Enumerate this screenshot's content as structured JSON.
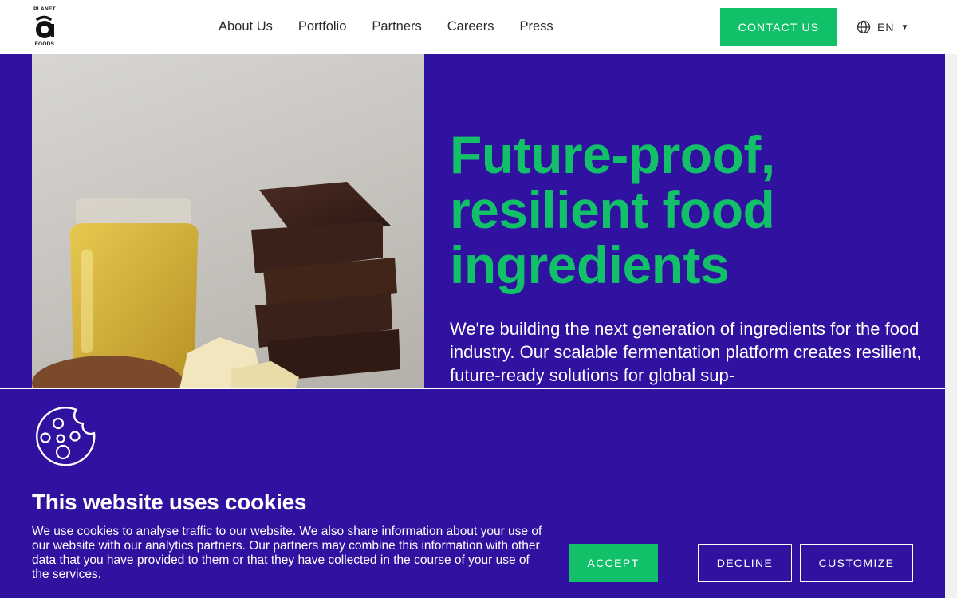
{
  "header": {
    "logo": {
      "top_text": "PLANET",
      "bottom_text": "FOODS"
    },
    "nav": [
      {
        "label": "About Us"
      },
      {
        "label": "Portfolio"
      },
      {
        "label": "Partners"
      },
      {
        "label": "Careers"
      },
      {
        "label": "Press"
      }
    ],
    "contact_label": "CONTACT US",
    "language": {
      "icon": "globe-icon",
      "label": "EN",
      "caret": "▼"
    }
  },
  "hero": {
    "title_lines": [
      "Future-proof,",
      "resilient food",
      "ingredients"
    ],
    "body": "We're building the next generation of ingredients for the food industry. Our scalable fermentation platform creates resilient, future-ready solutions for global sup-",
    "image_alt_content": "jar of oil, chocolate pieces, cocoa butter and cocoa powder"
  },
  "cookie_banner": {
    "icon": "cookie-icon",
    "title": "This website uses cookies",
    "text": "We use cookies to analyse traffic to our website. We also share information about your use of our website with our analytics partners. Our partners may combine this information with other data that you have provided to them or that they have collected in the course of your use of the services.",
    "accept_label": "ACCEPT",
    "decline_label": "DECLINE",
    "customize_label": "CUSTOMIZE"
  },
  "colors": {
    "brand_purple": "#3011a0",
    "accent_green": "#12c06a",
    "white": "#ffffff"
  }
}
